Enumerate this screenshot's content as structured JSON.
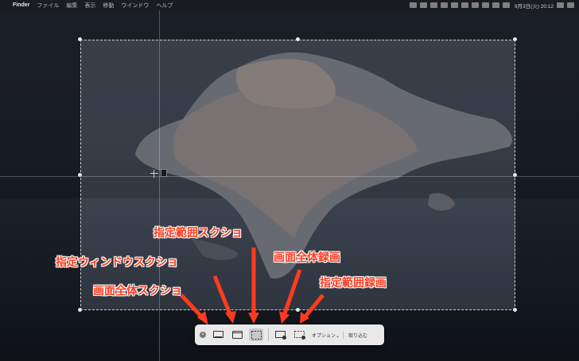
{
  "menubar": {
    "apple": "",
    "app": "Finder",
    "items": [
      "ファイル",
      "編集",
      "表示",
      "移動",
      "ウインドウ",
      "ヘルプ"
    ],
    "clock": "9月3日(火) 20:12"
  },
  "toolbar": {
    "close_label": "×",
    "options_label": "オプション⌄",
    "capture_label": "取り込む"
  },
  "annotations": {
    "region_screenshot": "指定範囲スクショ",
    "window_screenshot": "指定ウィンドウスクショ",
    "full_record": "画面全体録画",
    "region_record": "指定範囲録画",
    "full_screenshot": "画面全体スクショ"
  },
  "colors": {
    "annotation": "#ff3b1f"
  }
}
